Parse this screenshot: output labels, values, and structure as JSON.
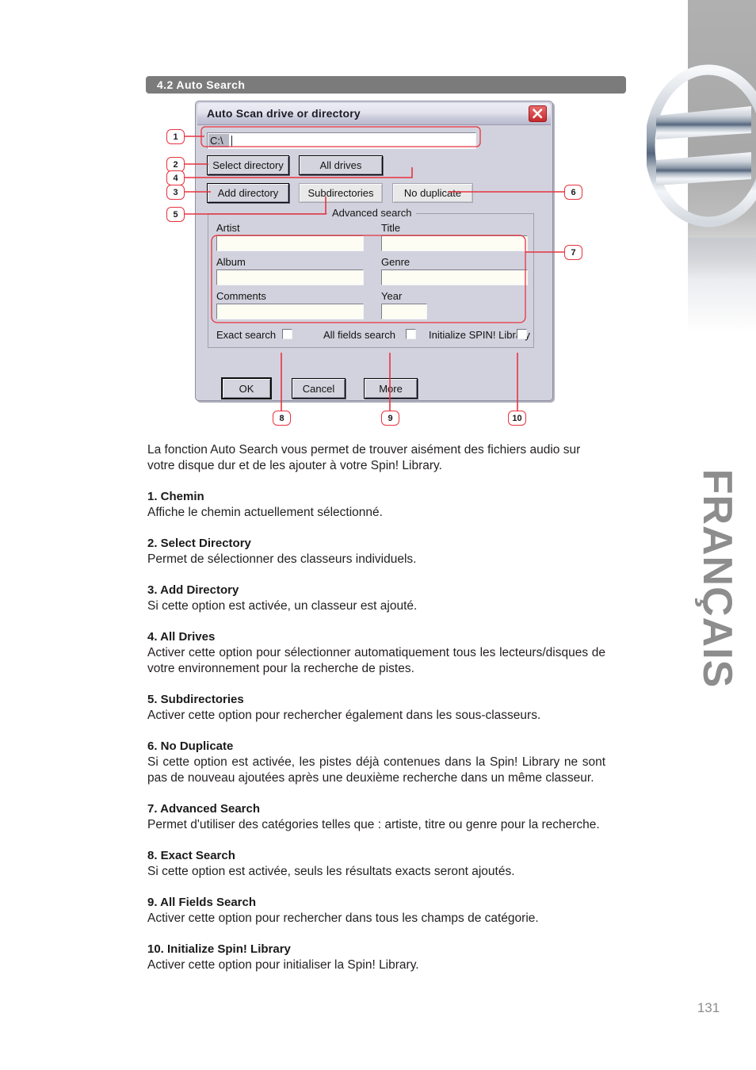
{
  "section": {
    "number": "4.2",
    "title": "4.2 Auto Search"
  },
  "dialog": {
    "title": "Auto Scan drive or directory",
    "close_icon": "close-icon",
    "path": {
      "value": "C:\\",
      "placeholder": ""
    },
    "buttons": {
      "select_directory": "Select directory",
      "all_drives": "All drives",
      "add_directory": "Add directory",
      "subdirectories": "Subdirectories",
      "no_duplicate": "No duplicate",
      "ok": "OK",
      "cancel": "Cancel",
      "more": "More"
    },
    "advanced": {
      "legend": "Advanced search",
      "fields": {
        "artist_label": "Artist",
        "artist_value": "",
        "title_label": "Title",
        "title_value": "",
        "album_label": "Album",
        "album_value": "",
        "genre_label": "Genre",
        "genre_value": "",
        "comments_label": "Comments",
        "comments_value": "",
        "year_label": "Year",
        "year_value": ""
      },
      "checkboxes": {
        "exact_search": "Exact search",
        "all_fields_search": "All fields search",
        "initialize_spin_library": "Initialize SPIN! Library"
      }
    }
  },
  "callouts": {
    "c1": "1",
    "c2": "2",
    "c3": "3",
    "c4": "4",
    "c5": "5",
    "c6": "6",
    "c7": "7",
    "c8": "8",
    "c9": "9",
    "c10": "10"
  },
  "copy": {
    "intro": "La fonction Auto Search vous permet de trouver aisément des fichiers audio sur votre disque dur et de les ajouter à votre Spin! Library.",
    "entries": [
      {
        "heading": "1. Chemin",
        "body": "Affiche le chemin actuellement sélectionné."
      },
      {
        "heading": "2. Select Directory",
        "body": "Permet de sélectionner des classeurs individuels."
      },
      {
        "heading": "3. Add Directory",
        "body": "Si cette option est activée, un classeur est ajouté."
      },
      {
        "heading": "4. All Drives",
        "body": "Activer cette option pour sélectionner automatiquement tous les lecteurs/disques de votre environnement pour la recherche de pistes."
      },
      {
        "heading": "5. Subdirectories",
        "body": "Activer cette option pour rechercher également dans les sous-classeurs."
      },
      {
        "heading": "6. No Duplicate",
        "body": "Si cette option est activée, les pistes déjà contenues dans la Spin! Library ne sont pas de nouveau ajoutées après une deuxième recherche dans un même classeur."
      },
      {
        "heading": "7. Advanced Search",
        "body": "Permet d'utiliser des catégories telles que : artiste, titre ou genre pour la recherche."
      },
      {
        "heading": "8. Exact Search",
        "body": "Si cette option est activée, seuls les résultats exacts seront ajoutés."
      },
      {
        "heading": "9. All Fields Search",
        "body": "Activer cette option pour rechercher dans tous les champs de catégorie."
      },
      {
        "heading": "10. Initialize Spin! Library",
        "body": "Activer cette option pour initialiser la Spin! Library."
      }
    ]
  },
  "sidebar": {
    "language_label": "FRANÇAIS"
  },
  "footer": {
    "page_number": "131"
  },
  "colors": {
    "section_bar": "#7b7b7b",
    "callout_red": "#e8333f",
    "dialog_face": "#d2d2de",
    "close_red": "#c8282c",
    "muted_gray": "#8d8d8d"
  }
}
